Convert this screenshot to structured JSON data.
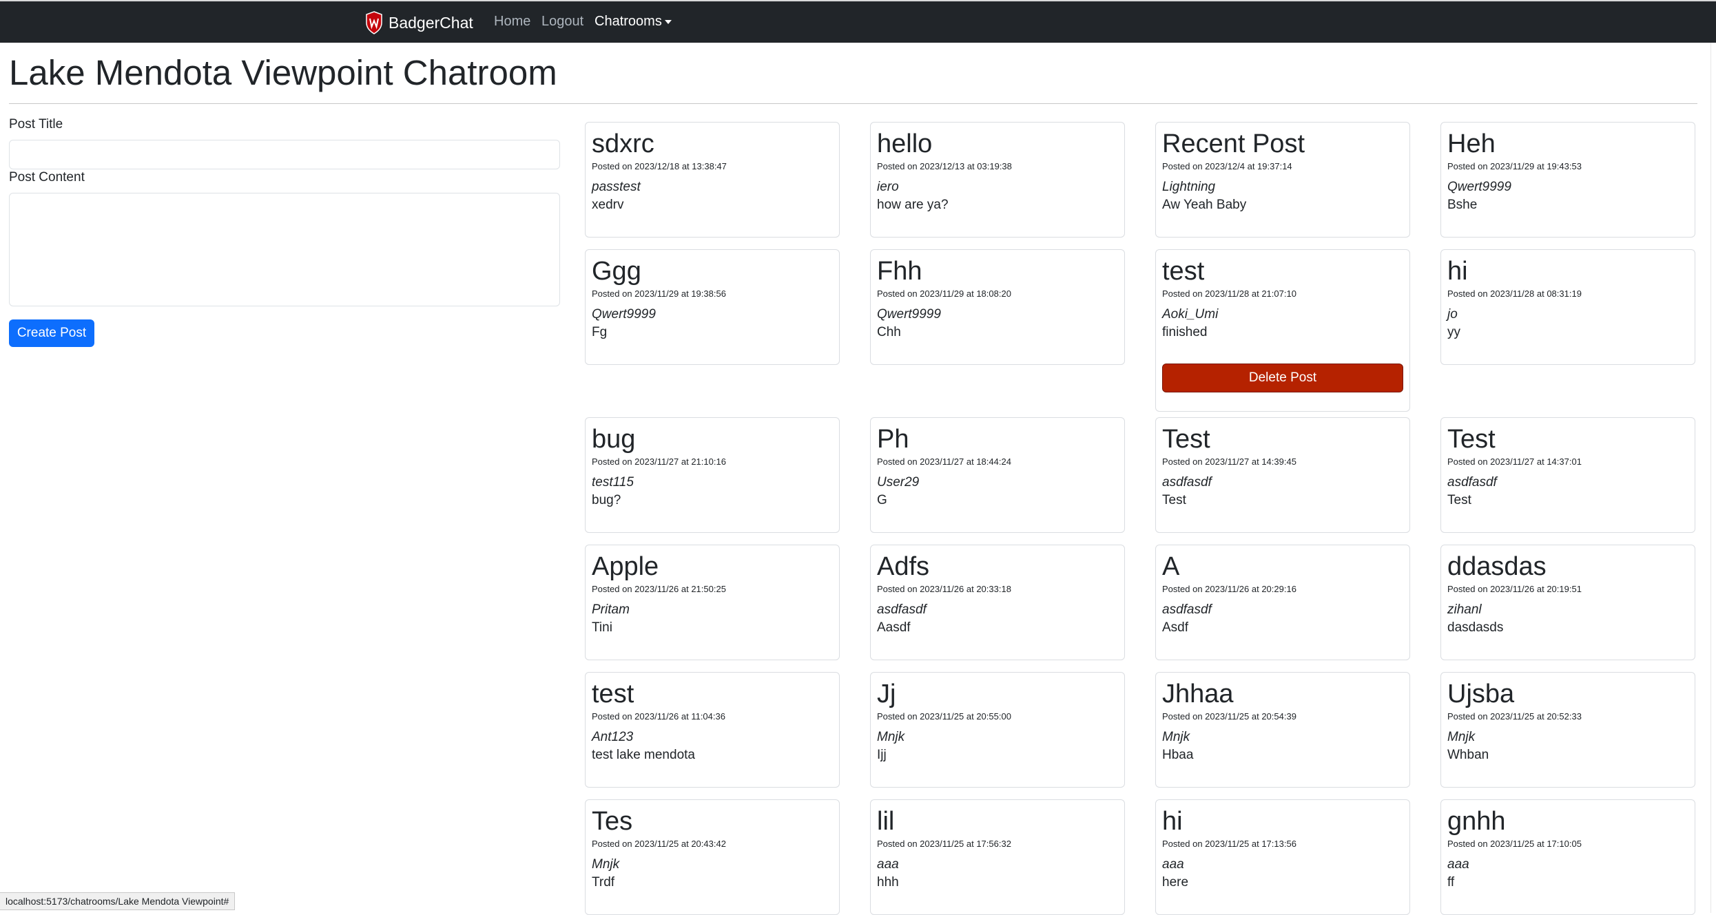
{
  "navbar": {
    "brand": "BadgerChat",
    "links": {
      "home": "Home",
      "logout": "Logout",
      "chatrooms": "Chatrooms"
    }
  },
  "page": {
    "title": "Lake Mendota Viewpoint Chatroom"
  },
  "form": {
    "title_label": "Post Title",
    "title_value": "",
    "content_label": "Post Content",
    "content_value": "",
    "create_button": "Create Post"
  },
  "posts": [
    {
      "title": "sdxrc",
      "date": "Posted on 2023/12/18 at 13:38:47",
      "author": "passtest",
      "content": "xedrv"
    },
    {
      "title": "hello",
      "date": "Posted on 2023/12/13 at 03:19:38",
      "author": "iero",
      "content": "how are ya?"
    },
    {
      "title": "Recent Post",
      "date": "Posted on 2023/12/4 at 19:37:14",
      "author": "Lightning",
      "content": "Aw Yeah Baby"
    },
    {
      "title": "Heh",
      "date": "Posted on 2023/11/29 at 19:43:53",
      "author": "Qwert9999",
      "content": "Bshe"
    },
    {
      "title": "Ggg",
      "date": "Posted on 2023/11/29 at 19:38:56",
      "author": "Qwert9999",
      "content": "Fg"
    },
    {
      "title": "Fhh",
      "date": "Posted on 2023/11/29 at 18:08:20",
      "author": "Qwert9999",
      "content": "Chh"
    },
    {
      "title": "test",
      "date": "Posted on 2023/11/28 at 21:07:10",
      "author": "Aoki_Umi",
      "content": "finished",
      "delete_label": "Delete Post"
    },
    {
      "title": "hi",
      "date": "Posted on 2023/11/28 at 08:31:19",
      "author": "jo",
      "content": "yy"
    },
    {
      "title": "bug",
      "date": "Posted on 2023/11/27 at 21:10:16",
      "author": "test115",
      "content": "bug?"
    },
    {
      "title": "Ph",
      "date": "Posted on 2023/11/27 at 18:44:24",
      "author": "User29",
      "content": "G"
    },
    {
      "title": "Test",
      "date": "Posted on 2023/11/27 at 14:39:45",
      "author": "asdfasdf",
      "content": "Test"
    },
    {
      "title": "Test",
      "date": "Posted on 2023/11/27 at 14:37:01",
      "author": "asdfasdf",
      "content": "Test"
    },
    {
      "title": "Apple",
      "date": "Posted on 2023/11/26 at 21:50:25",
      "author": "Pritam",
      "content": "Tini"
    },
    {
      "title": "Adfs",
      "date": "Posted on 2023/11/26 at 20:33:18",
      "author": "asdfasdf",
      "content": "Aasdf"
    },
    {
      "title": "A",
      "date": "Posted on 2023/11/26 at 20:29:16",
      "author": "asdfasdf",
      "content": "Asdf"
    },
    {
      "title": "ddasdas",
      "date": "Posted on 2023/11/26 at 20:19:51",
      "author": "zihanl",
      "content": "dasdasds"
    },
    {
      "title": "test",
      "date": "Posted on 2023/11/26 at 11:04:36",
      "author": "Ant123",
      "content": "test lake mendota"
    },
    {
      "title": "Jj",
      "date": "Posted on 2023/11/25 at 20:55:00",
      "author": "Mnjk",
      "content": "Ijj"
    },
    {
      "title": "Jhhaa",
      "date": "Posted on 2023/11/25 at 20:54:39",
      "author": "Mnjk",
      "content": "Hbaa"
    },
    {
      "title": "Ujsba",
      "date": "Posted on 2023/11/25 at 20:52:33",
      "author": "Mnjk",
      "content": "Whban"
    },
    {
      "title": "Tes",
      "date": "Posted on 2023/11/25 at 20:43:42",
      "author": "Mnjk",
      "content": "Trdf"
    },
    {
      "title": "lil",
      "date": "Posted on 2023/11/25 at 17:56:32",
      "author": "aaa",
      "content": "hhh"
    },
    {
      "title": "hi",
      "date": "Posted on 2023/11/25 at 17:13:56",
      "author": "aaa",
      "content": "here"
    },
    {
      "title": "gnhh",
      "date": "Posted on 2023/11/25 at 17:10:05",
      "author": "aaa",
      "content": "ff"
    }
  ],
  "status_bar": {
    "url": "localhost:5173/chatrooms/Lake Mendota Viewpoint#"
  },
  "colors": {
    "navbar": "#212529",
    "primary": "#0d6efd",
    "danger": "#b52200"
  }
}
